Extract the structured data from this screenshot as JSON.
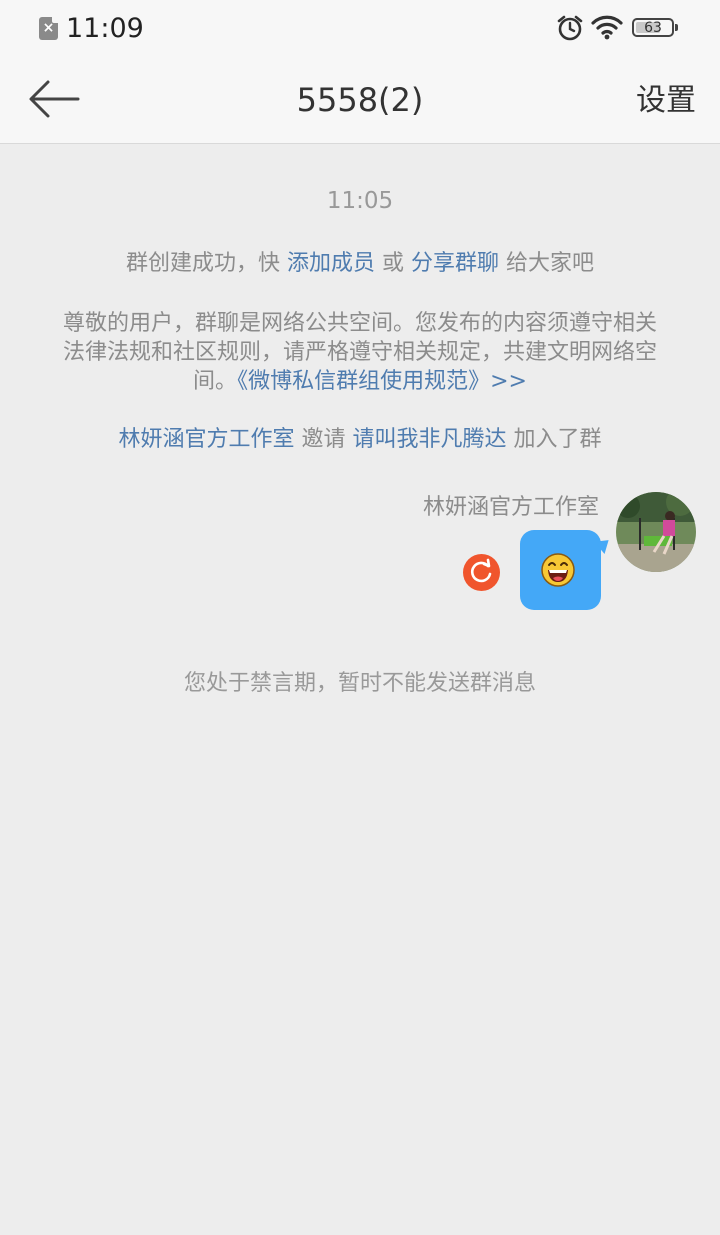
{
  "status_bar": {
    "time": "11:09",
    "sim_status": "×",
    "battery_level": "63",
    "icons": [
      "sim-off-icon",
      "alarm-icon",
      "wifi-icon",
      "battery-icon"
    ]
  },
  "header": {
    "back_icon": "arrow-left-icon",
    "title": "5558(2)",
    "settings_label": "设置"
  },
  "chat": {
    "timestamp": "11:05",
    "system_notice": {
      "prefix": "群创建成功，快 ",
      "add_members_link": "添加成员",
      "middle": " 或 ",
      "share_link": "分享群聊",
      "suffix": " 给大家吧"
    },
    "policy_notice": {
      "text": "尊敬的用户，群聊是网络公共空间。您发布的内容须遵守相关法律法规和社区规则，请严格遵守相关规定，共建文明网络空间。",
      "link": "《微博私信群组使用规范》>>"
    },
    "invite_notice": {
      "inviter": "林妍涵官方工作室",
      "verb": " 邀请 ",
      "invitee": "请叫我非凡腾达",
      "suffix": " 加入了群"
    },
    "message": {
      "sender": "林妍涵官方工作室",
      "content_icon": "laughing-emoji-icon",
      "status_icon": "resend-icon"
    },
    "mute_notice": "您处于禁言期，暂时不能发送群消息"
  },
  "colors": {
    "background": "#ededed",
    "link": "#4f7caf",
    "bubble": "#44a8f7",
    "resend": "#f0552d"
  }
}
